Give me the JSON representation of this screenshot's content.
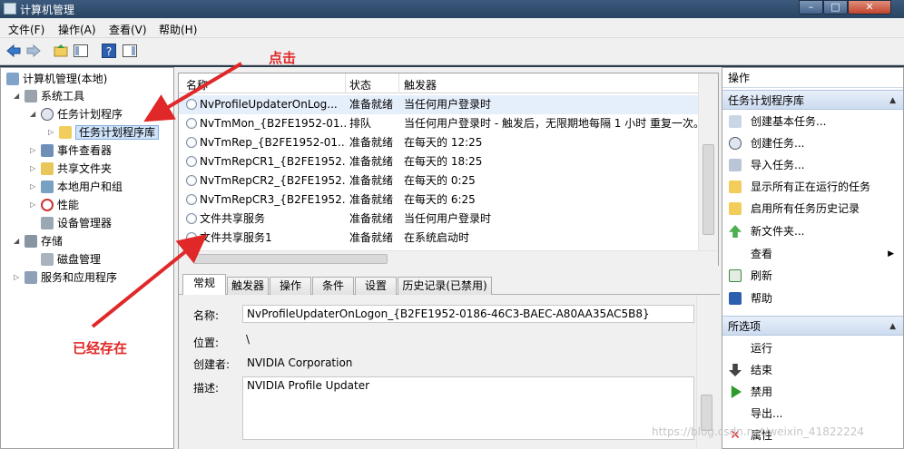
{
  "window": {
    "title": "计算机管理",
    "controls": {
      "minimize": "–",
      "maximize": "□",
      "close": "✕"
    }
  },
  "menu": [
    "文件(F)",
    "操作(A)",
    "查看(V)",
    "帮助(H)"
  ],
  "tree": {
    "items": [
      {
        "label": "计算机管理(本地)",
        "icon": "computer-icon"
      },
      {
        "label": "系统工具",
        "icon": "tools-icon"
      },
      {
        "label": "任务计划程序",
        "icon": "clock-icon"
      },
      {
        "label": "任务计划程序库",
        "icon": "folder-icon"
      },
      {
        "label": "事件查看器",
        "icon": "event-viewer-icon"
      },
      {
        "label": "共享文件夹",
        "icon": "shared-folder-icon"
      },
      {
        "label": "本地用户和组",
        "icon": "users-icon"
      },
      {
        "label": "性能",
        "icon": "performance-icon"
      },
      {
        "label": "设备管理器",
        "icon": "device-manager-icon"
      },
      {
        "label": "存储",
        "icon": "storage-icon"
      },
      {
        "label": "磁盘管理",
        "icon": "disk-icon"
      },
      {
        "label": "服务和应用程序",
        "icon": "services-icon"
      }
    ]
  },
  "tasklist": {
    "columns": [
      "名称",
      "状态",
      "触发器"
    ],
    "rows": [
      {
        "name": "NvProfileUpdaterOnLog...",
        "status": "准备就绪",
        "trigger": "当任何用户登录时"
      },
      {
        "name": "NvTmMon_{B2FE1952-01...",
        "status": "排队",
        "trigger": "当任何用户登录时 - 触发后，无限期地每隔 1 小时 重复一次。"
      },
      {
        "name": "NvTmRep_{B2FE1952-01...",
        "status": "准备就绪",
        "trigger": "在每天的 12:25"
      },
      {
        "name": "NvTmRepCR1_{B2FE1952...",
        "status": "准备就绪",
        "trigger": "在每天的 18:25"
      },
      {
        "name": "NvTmRepCR2_{B2FE1952...",
        "status": "准备就绪",
        "trigger": "在每天的 0:25"
      },
      {
        "name": "NvTmRepCR3_{B2FE1952...",
        "status": "准备就绪",
        "trigger": "在每天的 6:25"
      },
      {
        "name": "文件共享服务",
        "status": "准备就绪",
        "trigger": "当任何用户登录时"
      },
      {
        "name": "文件共享服务1",
        "status": "准备就绪",
        "trigger": "在系统启动时"
      }
    ]
  },
  "tabs": [
    "常规",
    "触发器",
    "操作",
    "条件",
    "设置",
    "历史记录(已禁用)"
  ],
  "detail": {
    "name_label": "名称:",
    "name_value": "NvProfileUpdaterOnLogon_{B2FE1952-0186-46C3-BAEC-A80AA35AC5B8}",
    "location_label": "位置:",
    "location_value": "\\",
    "author_label": "创建者:",
    "author_value": "NVIDIA Corporation",
    "description_label": "描述:",
    "description_value": "NVIDIA Profile Updater"
  },
  "actions": {
    "title": "操作",
    "section1": "任务计划程序库",
    "items1": [
      "创建基本任务...",
      "创建任务...",
      "导入任务...",
      "显示所有正在运行的任务",
      "启用所有任务历史记录",
      "新文件夹...",
      "查看",
      "刷新",
      "帮助"
    ],
    "section2": "所选项",
    "items2": [
      "运行",
      "结束",
      "禁用",
      "导出...",
      "属性"
    ]
  },
  "annotations": {
    "click_note": "点击",
    "exists_note": "已经存在"
  },
  "watermark": "https://blog.csdn.net/weixin_41822224",
  "colors": {
    "accent": "#e02828",
    "selection": "#cfe3fb",
    "section_header": "#cddcf0"
  }
}
